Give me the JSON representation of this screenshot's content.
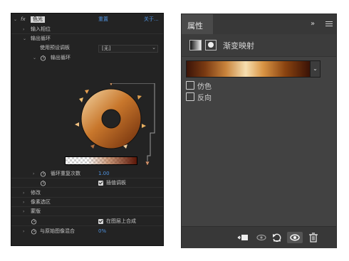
{
  "effect": {
    "fx": "fx",
    "name": "色光",
    "reset": "重置",
    "about": "关于..."
  },
  "rows": {
    "input_phase": "输入相位",
    "output_cycle": "输出循环",
    "use_preset_label": "使用预设调板",
    "preset_value": "[无]",
    "output_cycle_sub": "输出循环",
    "cycle_repeat_label": "循环重复次数",
    "cycle_repeat_value": "1.00",
    "interpolate_palette": "插值调板",
    "modify": "修改",
    "pixel_selection": "像素选区",
    "mask": "蒙版",
    "composite_on_layer": "在图层上合成",
    "blend_with_original": "与原始图像混合",
    "blend_value": "0%"
  },
  "properties": {
    "tab": "属性",
    "collapse": "»",
    "title": "渐变映射",
    "dither": "仿色",
    "reverse": "反向",
    "checkboxes": {
      "dither": false,
      "reverse": false
    }
  },
  "colors": {
    "blue_value": "#4f93e0",
    "panel_dark": "#232323",
    "ps_panel": "#424242"
  },
  "icons": {
    "stopwatch": "stopwatch-icon",
    "clip": "clip-to-layer-icon",
    "view_previous": "view-previous-state-icon",
    "reset": "reset-icon",
    "visibility": "eye-icon",
    "delete": "trash-icon"
  }
}
